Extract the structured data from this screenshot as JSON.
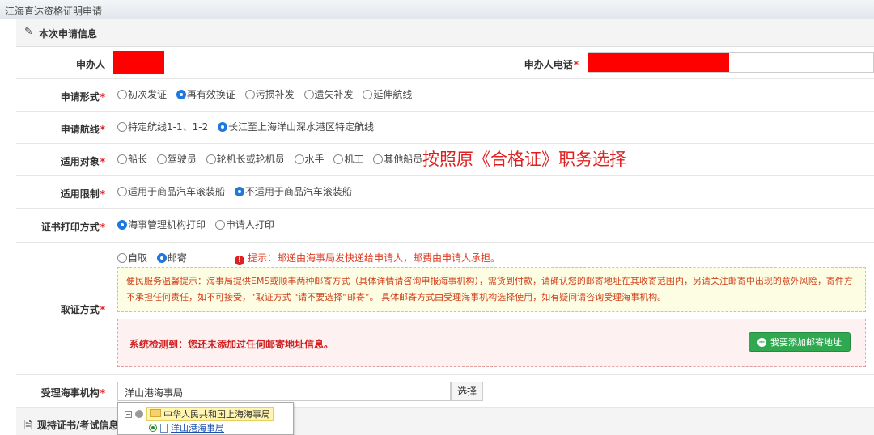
{
  "window": {
    "title": "江海直达资格证明申请"
  },
  "section": {
    "icon": "edit-icon",
    "title": "本次申请信息"
  },
  "applicant": {
    "label": "申办人",
    "phone_label": "申办人电话"
  },
  "form_type": {
    "label": "申请形式",
    "options": [
      "初次发证",
      "再有效换证",
      "污损补发",
      "遗失补发",
      "延伸航线"
    ],
    "selected": "再有效换证"
  },
  "route": {
    "label": "申请航线",
    "options": [
      "特定航线1-1、1-2",
      "长江至上海洋山深水港区特定航线"
    ],
    "selected": "长江至上海洋山深水港区特定航线"
  },
  "target": {
    "label": "适用对象",
    "options": [
      "船长",
      "驾驶员",
      "轮机长或轮机员",
      "水手",
      "机工",
      "其他船员"
    ],
    "selected": "",
    "annotation": "按照原《合格证》职务选择"
  },
  "restriction": {
    "label": "适用限制",
    "options": [
      "适用于商品汽车滚装船",
      "不适用于商品汽车滚装船"
    ],
    "selected": "不适用于商品汽车滚装船"
  },
  "print_method": {
    "label": "证书打印方式",
    "options": [
      "海事管理机构打印",
      "申请人打印"
    ],
    "selected": "海事管理机构打印"
  },
  "pickup": {
    "label": "取证方式",
    "options": [
      "自取",
      "邮寄"
    ],
    "selected": "邮寄",
    "tip": "提示：邮递由海事局发快递给申请人，邮费由申请人承担。",
    "notice": "便民服务温馨提示：海事局提供EMS或顺丰两种邮寄方式（具体详情请咨询申报海事机构），需货到付款，请确认您的邮寄地址在其收寄范围内，另请关注邮寄中出现的意外风险，寄件方不承担任何责任，如不可接受，“取证方式 \"请不要选择“邮寄”。 具体邮寄方式由受理海事机构选择使用，如有疑问请咨询受理海事机构。",
    "warning": "系统检测到：您还未添加过任何邮寄地址信息。",
    "add_button": "我要添加邮寄地址"
  },
  "org": {
    "label": "受理海事机构",
    "value": "洋山港海事局",
    "select_button": "选择",
    "tree": {
      "root": "中华人民共和国上海海事局",
      "child": "洋山港海事局"
    }
  },
  "next_section": {
    "icon": "document-icon",
    "title": "现持证书/考试信息"
  },
  "required_mark": "*",
  "colors": {
    "accent": "#1f78e0",
    "required": "#e02020",
    "add_button": "#2fa84f"
  }
}
